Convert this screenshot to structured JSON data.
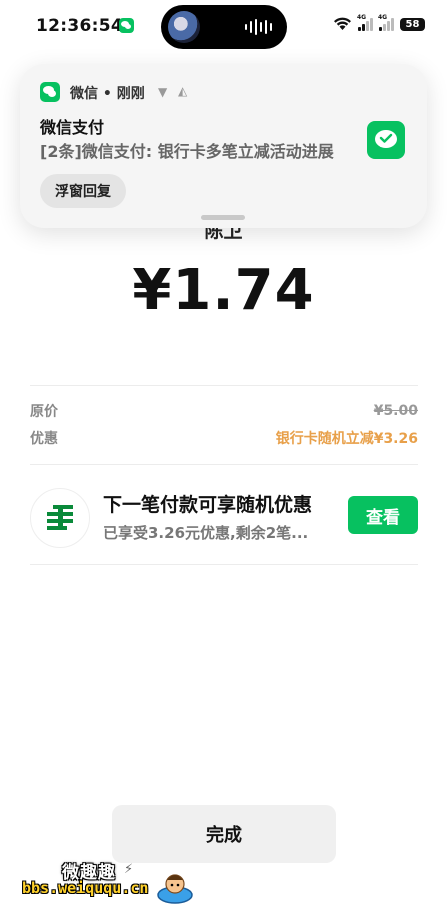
{
  "status_bar": {
    "time": "12:36:54",
    "signal_label_1": "4G",
    "signal_label_2": "4G",
    "battery": "58"
  },
  "notification": {
    "app_name": "微信 • 刚刚",
    "title": "微信支付",
    "body": "[2条]微信支付: 银行卡多笔立减活动进展",
    "reply_button": "浮窗回复"
  },
  "payment": {
    "partial_title": "陈卫",
    "amount": "¥1.74",
    "rows": [
      {
        "label": "原价",
        "value": "¥5.00"
      },
      {
        "label": "优惠",
        "value": "银行卡随机立减¥3.26"
      }
    ]
  },
  "promo": {
    "title": "下一笔付款可享随机优惠",
    "subtitle": "已享受3.26元优惠,剩余2笔...",
    "button": "查看"
  },
  "done_button": "完成",
  "watermark": {
    "line1": "微趣趣",
    "line2": "bbs.weiququ.cn"
  },
  "colors": {
    "accent": "#07c160",
    "discount": "#e8a04a"
  }
}
